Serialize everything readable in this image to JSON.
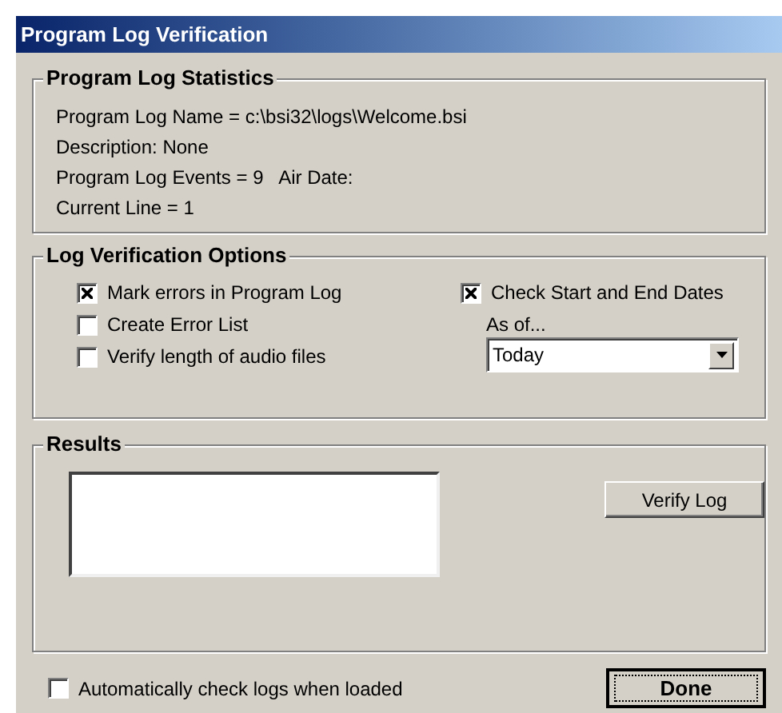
{
  "window": {
    "title": "Program Log Verification"
  },
  "statistics": {
    "title": "Program Log Statistics",
    "lines": [
      "Program Log Name = c:\\bsi32\\logs\\Welcome.bsi",
      "Description: None",
      "Program Log Events = 9   Air Date:",
      "Current Line = 1"
    ]
  },
  "options": {
    "title": "Log Verification Options",
    "left": [
      {
        "label": "Mark errors in Program Log",
        "checked": true
      },
      {
        "label": "Create Error List",
        "checked": false
      },
      {
        "label": "Verify length of audio files",
        "checked": false
      }
    ],
    "right": {
      "label": "Check Start and End Dates",
      "checked": true
    },
    "as_of_label": "As of...",
    "as_of_value": "Today"
  },
  "results": {
    "title": "Results",
    "button": "Verify Log"
  },
  "auto_check": {
    "label": "Automatically check logs when loaded",
    "checked": false
  },
  "done_button": "Done"
}
